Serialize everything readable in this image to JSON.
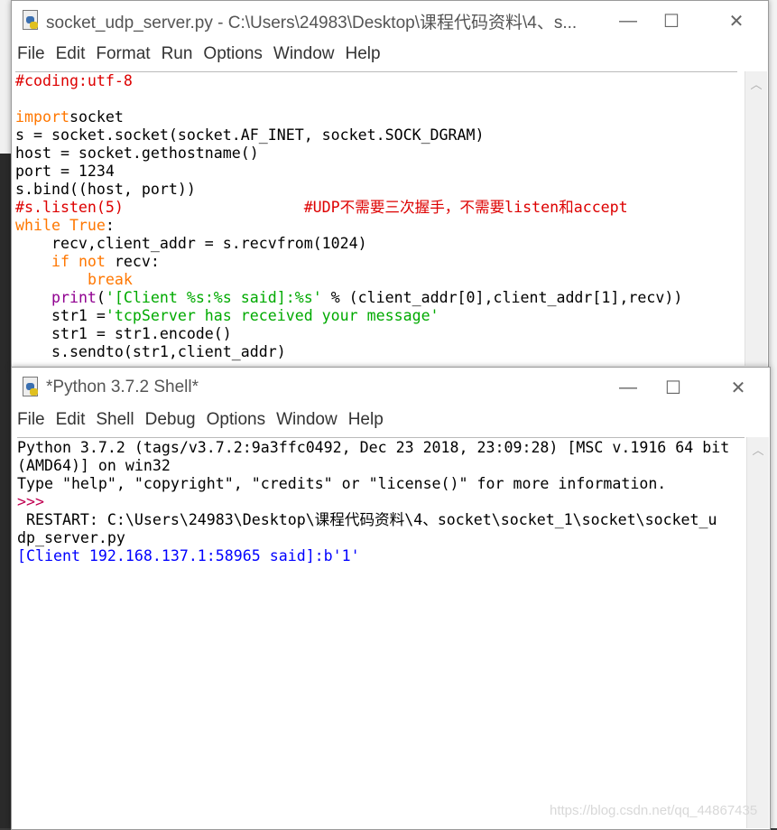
{
  "colors": {
    "keyword": "#ff7700",
    "string": "#00aa00",
    "comment": "#dd0000",
    "builtin": "#900090",
    "stdout": "#0000ff",
    "prompt": "#c00050"
  },
  "editor": {
    "title": "socket_udp_server.py - C:\\Users\\24983\\Desktop\\课程代码资料\\4、s...",
    "menu": [
      "File",
      "Edit",
      "Format",
      "Run",
      "Options",
      "Window",
      "Help"
    ],
    "lines": [
      [
        [
          "cm",
          "#coding:utf-8"
        ]
      ],
      [],
      [
        [
          "kw",
          "import"
        ],
        [
          "",
          "socket"
        ]
      ],
      [
        [
          "",
          "s = socket.socket(socket.AF_INET, socket.SOCK_DGRAM)"
        ]
      ],
      [
        [
          "",
          "host = socket.gethostname()"
        ]
      ],
      [
        [
          "",
          "port = 1234"
        ]
      ],
      [
        [
          "",
          "s.bind((host, port))"
        ]
      ],
      [
        [
          "cm",
          "#s.listen(5)                    #UDP不需要三次握手，不需要listen和accept"
        ]
      ],
      [
        [
          "kw",
          "while"
        ],
        [
          "",
          ""
        ],
        [
          "kw",
          " True"
        ],
        [
          "",
          ":"
        ]
      ],
      [
        [
          "",
          "    recv,client_addr = s.recvfrom(1024)"
        ]
      ],
      [
        [
          "",
          "    "
        ],
        [
          "kw",
          "if not"
        ],
        [
          "",
          " recv:"
        ]
      ],
      [
        [
          "",
          "        "
        ],
        [
          "kw",
          "break"
        ]
      ],
      [
        [
          "",
          "    "
        ],
        [
          "bi",
          "print"
        ],
        [
          "",
          "("
        ],
        [
          "str",
          "'[Client %s:%s said]:%s'"
        ],
        [
          "",
          " % (client_addr[0],client_addr[1],recv))"
        ]
      ],
      [
        [
          "",
          "    str1 ="
        ],
        [
          "str",
          "'tcpServer has received your message'"
        ]
      ],
      [
        [
          "",
          "    str1 = str1.encode()"
        ]
      ],
      [
        [
          "",
          "    s.sendto(str1,client_addr)"
        ]
      ]
    ]
  },
  "shell": {
    "title": "*Python 3.7.2 Shell*",
    "menu": [
      "File",
      "Edit",
      "Shell",
      "Debug",
      "Options",
      "Window",
      "Help"
    ],
    "lines": [
      [
        [
          "",
          "Python 3.7.2 (tags/v3.7.2:9a3ffc0492, Dec 23 2018, 23:09:28) [MSC v.1916 64 bit"
        ]
      ],
      [
        [
          "",
          "(AMD64)] on win32"
        ]
      ],
      [
        [
          "",
          "Type \"help\", \"copyright\", \"credits\" or \"license()\" for more information."
        ]
      ],
      [
        [
          "prompt",
          ">>> "
        ]
      ],
      [
        [
          "",
          " RESTART: C:\\Users\\24983\\Desktop\\课程代码资料\\4、socket\\socket_1\\socket\\socket_u"
        ]
      ],
      [
        [
          "",
          "dp_server.py"
        ]
      ],
      [
        [
          "out",
          "[Client 192.168.137.1:58965 said]:b'1'"
        ]
      ]
    ]
  },
  "watermark": "https://blog.csdn.net/qq_44867435"
}
